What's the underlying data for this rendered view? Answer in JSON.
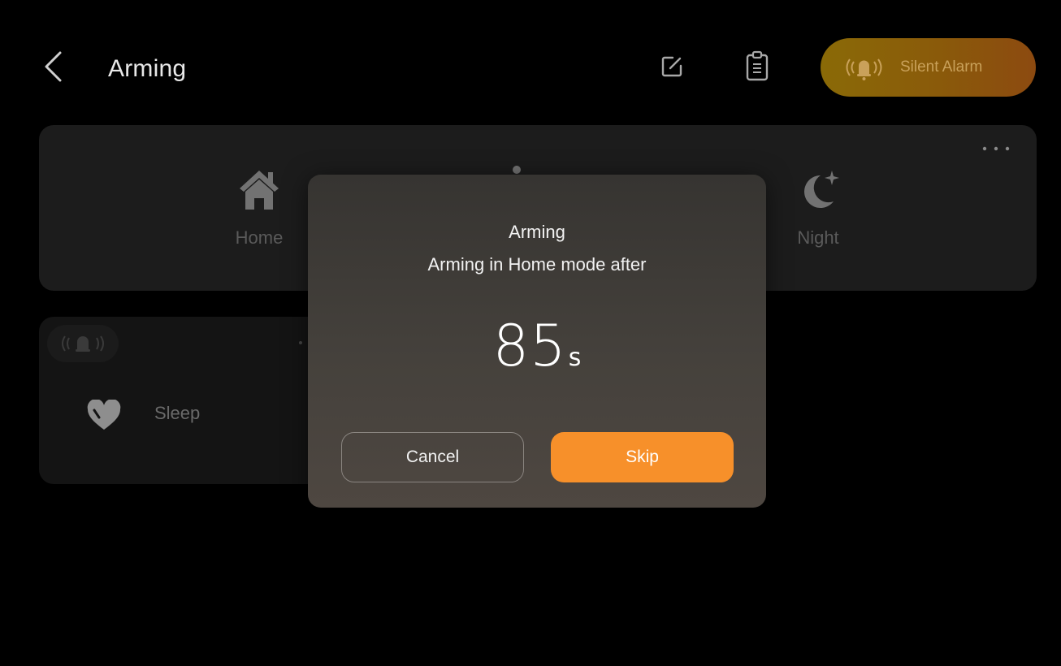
{
  "header": {
    "title": "Arming",
    "silent_alarm_label": "Silent Alarm"
  },
  "modes": [
    {
      "label": "Home",
      "icon": "house-icon"
    },
    {
      "label": "Night",
      "icon": "moon-icon"
    }
  ],
  "scenes": [
    {
      "label": "Sleep",
      "icon": "heart-icon"
    }
  ],
  "dialog": {
    "title": "Arming",
    "message": "Arming in Home mode after",
    "countdown_value": "85",
    "countdown_unit": "s",
    "cancel_label": "Cancel",
    "skip_label": "Skip"
  },
  "colors": {
    "accent": "#f7902a",
    "silent_alarm_bg": "#8a6a07",
    "background": "#000000",
    "card_bg": "#1c1c1c",
    "dialog_bg": "#45413c"
  }
}
